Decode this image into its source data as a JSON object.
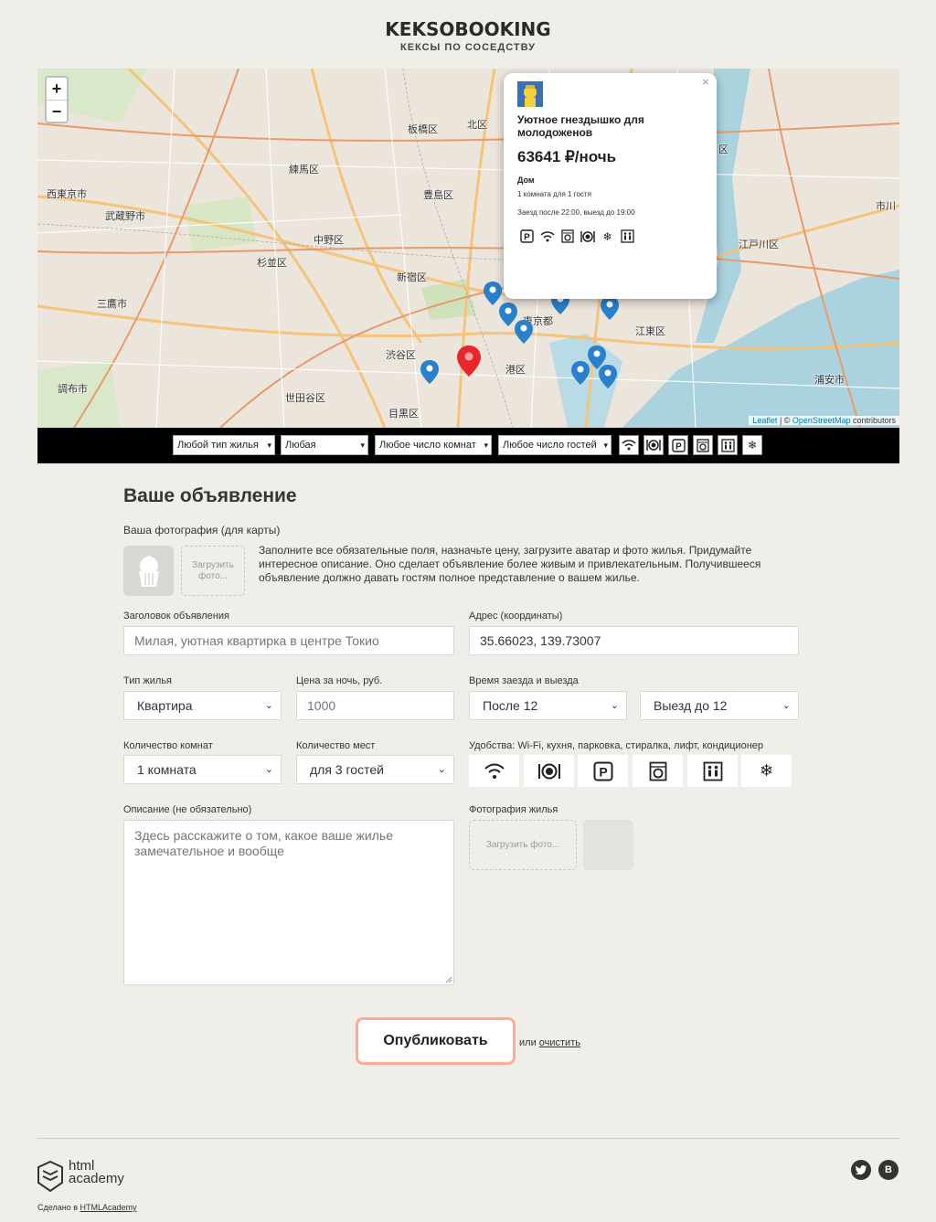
{
  "header": {
    "title": "KEKSOBOOKING",
    "subtitle": "КЕКСЫ ПО СОСЕДСТВУ"
  },
  "map": {
    "zoom_in": "+",
    "zoom_out": "−",
    "attribution_leaflet": "Leaflet",
    "attribution_sep": " | © ",
    "attribution_osm": "OpenStreetMap",
    "attribution_tail": " contributors",
    "labels": [
      "板橋区",
      "北区",
      "練馬区",
      "西東京市",
      "武蔵野市",
      "中野区",
      "杉並区",
      "新宿区",
      "三鷹市",
      "東京都",
      "江東区",
      "渋谷区",
      "港区",
      "世田谷区",
      "調布市",
      "目黒区",
      "江戸川区",
      "浦安市",
      "豊島区",
      "市川",
      "区"
    ],
    "popup": {
      "close": "×",
      "title": "Уютное гнездышко для молодоженов",
      "price": "63641 ₽/ночь",
      "type": "Дом",
      "capacity": "1 комната для 1 гостя",
      "time": "Заезд после 22:00, выезд до 19:00",
      "features": [
        "parking-icon",
        "wifi-icon",
        "washer-icon",
        "dishwasher-icon",
        "conditioner-icon",
        "elevator-icon"
      ]
    }
  },
  "filters": {
    "type": "Любой тип жилья",
    "price": "Любая",
    "rooms": "Любое число комнат",
    "guests": "Любое число гостей",
    "features": [
      "wifi-icon",
      "dishwasher-icon",
      "parking-icon",
      "washer-icon",
      "elevator-icon",
      "conditioner-icon"
    ]
  },
  "form": {
    "heading": "Ваше объявление",
    "avatar_label": "Ваша фотография (для карты)",
    "upload_avatar": "Загрузить фото...",
    "hint": "Заполните все обязательные поля, назначьте цену, загрузите аватар и фото жилья. Придумайте интересное описание. Оно сделает объявление более живым и привлекательным. Получившееся объявление должно давать гостям полное представление о вашем жилье.",
    "title_label": "Заголовок объявления",
    "title_placeholder": "Милая, уютная квартирка в центре Токио",
    "address_label": "Адрес (координаты)",
    "address_value": "35.66023, 139.73007",
    "type_label": "Тип жилья",
    "type_value": "Квартира",
    "price_label": "Цена за ночь, руб.",
    "price_placeholder": "1000",
    "time_label": "Время заезда и выезда",
    "checkin_value": "После 12",
    "checkout_value": "Выезд до 12",
    "rooms_label": "Количество комнат",
    "rooms_value": "1 комната",
    "capacity_label": "Количество мест",
    "capacity_value": "для 3 гостей",
    "features_label": "Удобства: Wi-Fi, кухня, парковка, стиралка, лифт, кондиционер",
    "features": [
      "wifi-icon",
      "dishwasher-icon",
      "parking-icon",
      "washer-icon",
      "elevator-icon",
      "conditioner-icon"
    ],
    "description_label": "Описание (не обязательно)",
    "description_placeholder": "Здесь расскажите о том, какое ваше жилье замечательное и вообще",
    "photos_label": "Фотография жилья",
    "upload_photo": "Загрузить фото...",
    "submit": "Опубликовать",
    "reset_prefix": "или ",
    "reset_link": "очистить"
  },
  "footer": {
    "brand_line1": "html",
    "brand_line2": "academy",
    "made_prefix": "Сделано в ",
    "made_link": "HTMLAcademy",
    "social": [
      "twitter-icon",
      "vk-icon"
    ],
    "vk_letter": "B"
  },
  "colors": {
    "accent_border": "#ffaa99",
    "marker_main": "#e8262b",
    "marker_pin": "#2a81cb",
    "background": "#f0eee9"
  }
}
